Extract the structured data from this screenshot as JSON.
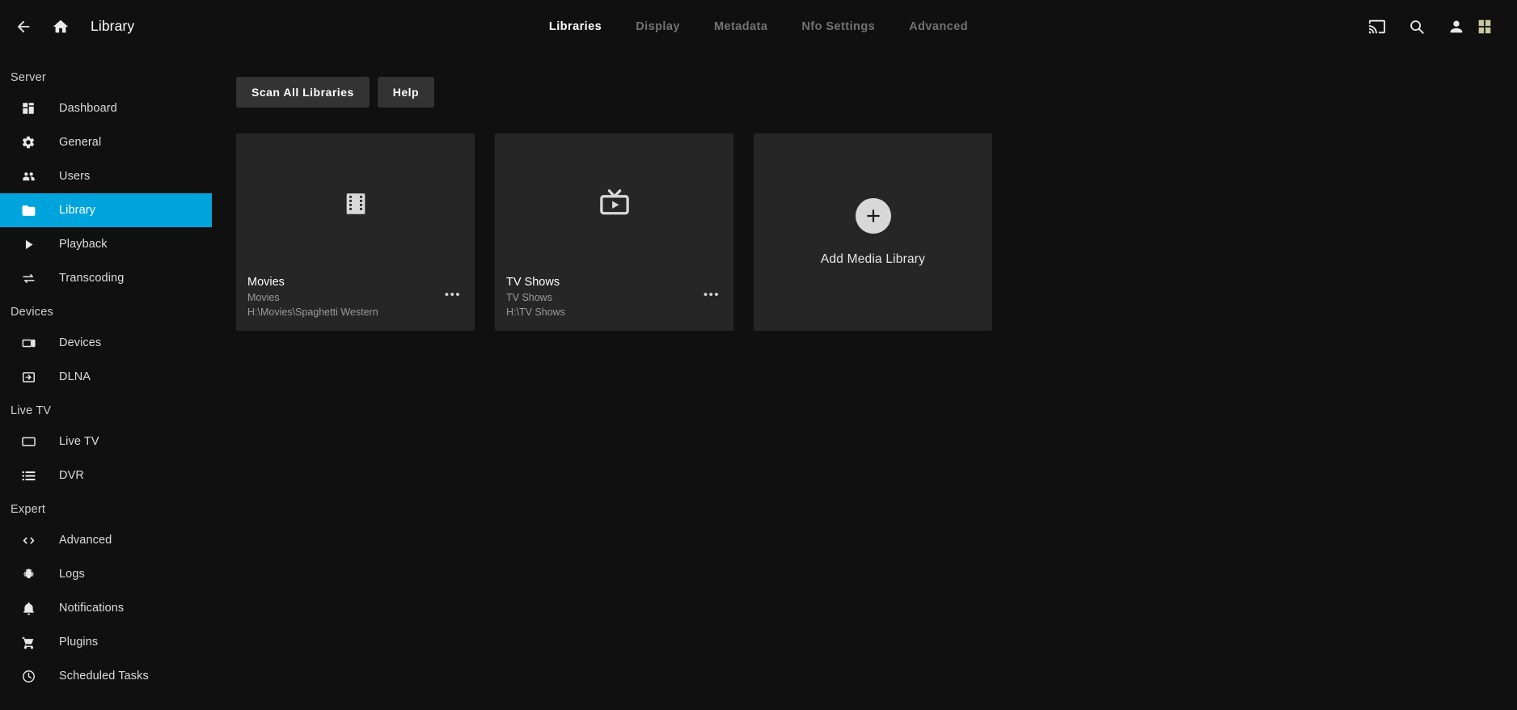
{
  "topbar": {
    "back_icon": "arrow-back-icon",
    "home_icon": "home-icon",
    "title": "Library",
    "tabs": [
      {
        "label": "Libraries",
        "active": true
      },
      {
        "label": "Display",
        "active": false
      },
      {
        "label": "Metadata",
        "active": false
      },
      {
        "label": "Nfo Settings",
        "active": false
      },
      {
        "label": "Advanced",
        "active": false
      }
    ],
    "right_icons": [
      "cast-icon",
      "search-icon",
      "person-icon",
      "grid-menu-icon"
    ]
  },
  "sidebar": {
    "sections": [
      {
        "header": "Server",
        "items": [
          {
            "label": "Dashboard",
            "icon": "dashboard-icon",
            "selected": false
          },
          {
            "label": "General",
            "icon": "gear-icon",
            "selected": false
          },
          {
            "label": "Users",
            "icon": "people-icon",
            "selected": false
          },
          {
            "label": "Library",
            "icon": "folder-icon",
            "selected": true
          },
          {
            "label": "Playback",
            "icon": "play-icon",
            "selected": false
          },
          {
            "label": "Transcoding",
            "icon": "transcode-icon",
            "selected": false
          }
        ]
      },
      {
        "header": "Devices",
        "items": [
          {
            "label": "Devices",
            "icon": "tablet-icon",
            "selected": false
          },
          {
            "label": "DLNA",
            "icon": "input-icon",
            "selected": false
          }
        ]
      },
      {
        "header": "Live TV",
        "items": [
          {
            "label": "Live TV",
            "icon": "tv-icon",
            "selected": false
          },
          {
            "label": "DVR",
            "icon": "list-icon",
            "selected": false
          }
        ]
      },
      {
        "header": "Expert",
        "items": [
          {
            "label": "Advanced",
            "icon": "code-icon",
            "selected": false
          },
          {
            "label": "Logs",
            "icon": "bug-icon",
            "selected": false
          },
          {
            "label": "Notifications",
            "icon": "bell-icon",
            "selected": false
          },
          {
            "label": "Plugins",
            "icon": "cart-icon",
            "selected": false
          },
          {
            "label": "Scheduled Tasks",
            "icon": "clock-icon",
            "selected": false
          }
        ]
      }
    ]
  },
  "main": {
    "buttons": [
      {
        "label": "Scan All Libraries"
      },
      {
        "label": "Help"
      }
    ],
    "libraries": [
      {
        "name": "Movies",
        "type": "Movies",
        "path": "H:\\Movies\\Spaghetti Western",
        "icon": "film-icon",
        "menu": "•••"
      },
      {
        "name": "TV Shows",
        "type": "TV Shows",
        "path": "H:\\TV Shows",
        "icon": "tv-play-icon",
        "menu": "•••"
      }
    ],
    "add_card": {
      "label": "Add Media Library",
      "icon": "plus-icon"
    }
  },
  "colors": {
    "accent": "#00a4dc",
    "background": "#101010",
    "card": "#262626",
    "button": "#333333",
    "muted_text": "#9a9a9a",
    "inactive_tab": "#727272"
  }
}
